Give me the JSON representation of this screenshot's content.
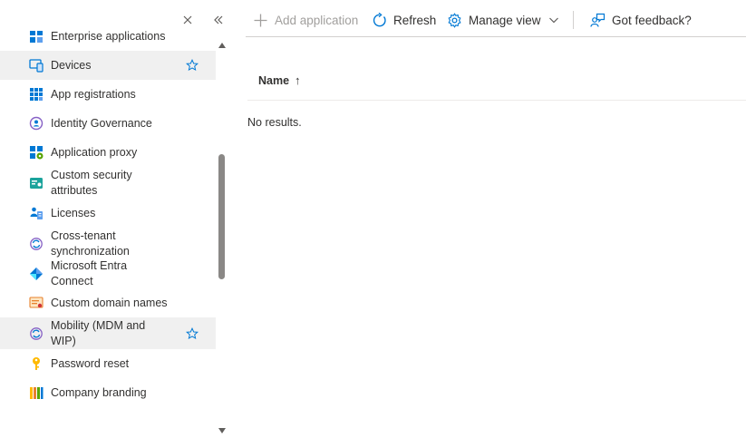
{
  "sidebar": {
    "close_label": "Close",
    "collapse_label": "Collapse",
    "items": [
      {
        "label": "Enterprise applications",
        "icon": "enterprise-apps-icon",
        "selected": false,
        "favorite": false
      },
      {
        "label": "Devices",
        "icon": "devices-icon",
        "selected": true,
        "favorite": true
      },
      {
        "label": "App registrations",
        "icon": "app-registrations-icon",
        "selected": false,
        "favorite": false
      },
      {
        "label": "Identity Governance",
        "icon": "identity-governance-icon",
        "selected": false,
        "favorite": false
      },
      {
        "label": "Application proxy",
        "icon": "application-proxy-icon",
        "selected": false,
        "favorite": false
      },
      {
        "label": "Custom security attributes",
        "icon": "custom-security-attributes-icon",
        "selected": false,
        "favorite": false
      },
      {
        "label": "Licenses",
        "icon": "licenses-icon",
        "selected": false,
        "favorite": false
      },
      {
        "label": "Cross-tenant synchronization",
        "icon": "cross-tenant-sync-icon",
        "selected": false,
        "favorite": false
      },
      {
        "label": "Microsoft Entra Connect",
        "icon": "entra-connect-icon",
        "selected": false,
        "favorite": false
      },
      {
        "label": "Custom domain names",
        "icon": "custom-domain-names-icon",
        "selected": false,
        "favorite": false
      },
      {
        "label": "Mobility (MDM and WIP)",
        "icon": "mobility-icon",
        "selected": true,
        "favorite": true
      },
      {
        "label": "Password reset",
        "icon": "password-reset-icon",
        "selected": false,
        "favorite": false
      },
      {
        "label": "Company branding",
        "icon": "company-branding-icon",
        "selected": false,
        "favorite": false
      }
    ]
  },
  "toolbar": {
    "add_application": "Add application",
    "refresh": "Refresh",
    "manage_view": "Manage view",
    "got_feedback": "Got feedback?"
  },
  "table": {
    "columns": [
      {
        "label": "Name",
        "sort": "↑"
      }
    ],
    "empty_message": "No results."
  },
  "colors": {
    "accent": "#0078d4",
    "selected_bg": "#f0f0f0",
    "text": "#323130",
    "disabled_text": "#a19f9d"
  }
}
